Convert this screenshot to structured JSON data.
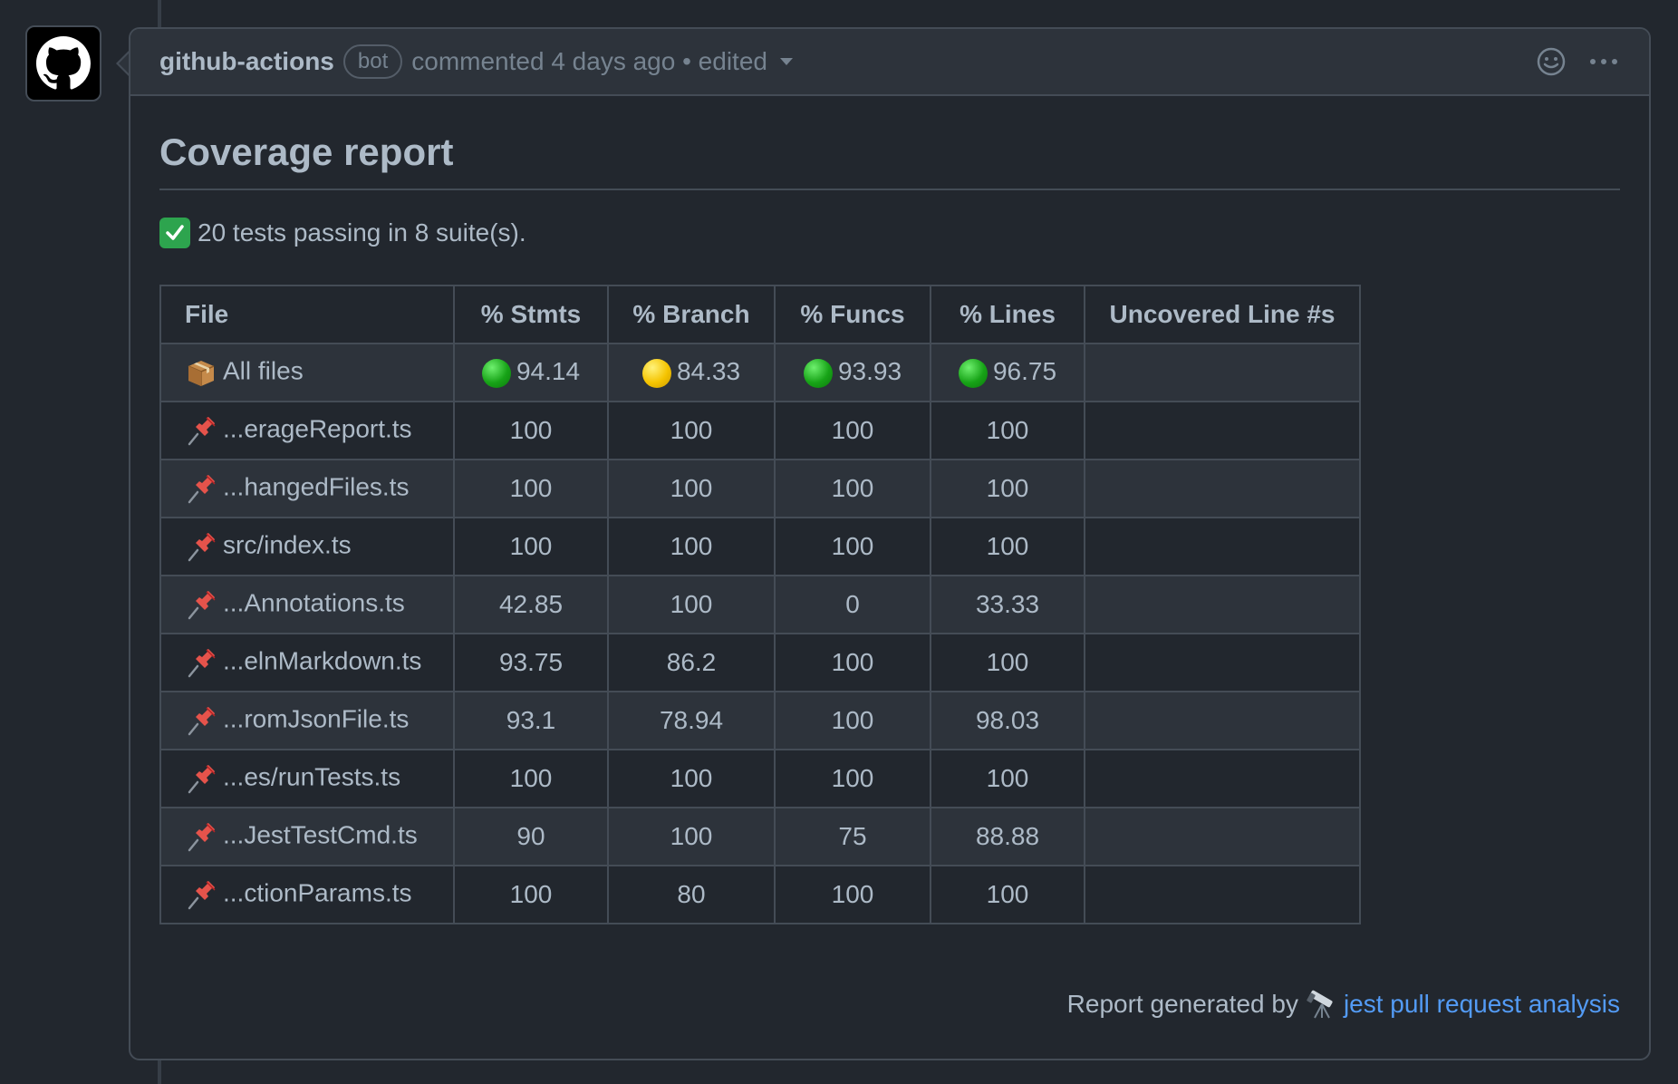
{
  "comment": {
    "author": "github-actions",
    "badge": "bot",
    "meta": "commented 4 days ago • edited"
  },
  "report": {
    "title": "Coverage report",
    "summary": "20 tests passing in 8 suite(s).",
    "columns": [
      "File",
      "% Stmts",
      "% Branch",
      "% Funcs",
      "% Lines",
      "Uncovered Line #s"
    ],
    "all_files": {
      "label": "All files",
      "stmts": "94.14",
      "branch": "84.33",
      "funcs": "93.93",
      "lines": "96.75",
      "uncovered": "",
      "status_colors": [
        "green",
        "yellow",
        "green",
        "green"
      ]
    },
    "rows": [
      {
        "file": "...erageReport.ts",
        "stmts": "100",
        "branch": "100",
        "funcs": "100",
        "lines": "100",
        "uncovered": ""
      },
      {
        "file": "...hangedFiles.ts",
        "stmts": "100",
        "branch": "100",
        "funcs": "100",
        "lines": "100",
        "uncovered": ""
      },
      {
        "file": "src/index.ts",
        "stmts": "100",
        "branch": "100",
        "funcs": "100",
        "lines": "100",
        "uncovered": ""
      },
      {
        "file": "...Annotations.ts",
        "stmts": "42.85",
        "branch": "100",
        "funcs": "0",
        "lines": "33.33",
        "uncovered": ""
      },
      {
        "file": "...elnMarkdown.ts",
        "stmts": "93.75",
        "branch": "86.2",
        "funcs": "100",
        "lines": "100",
        "uncovered": ""
      },
      {
        "file": "...romJsonFile.ts",
        "stmts": "93.1",
        "branch": "78.94",
        "funcs": "100",
        "lines": "98.03",
        "uncovered": ""
      },
      {
        "file": "...es/runTests.ts",
        "stmts": "100",
        "branch": "100",
        "funcs": "100",
        "lines": "100",
        "uncovered": ""
      },
      {
        "file": "...JestTestCmd.ts",
        "stmts": "90",
        "branch": "100",
        "funcs": "75",
        "lines": "88.88",
        "uncovered": ""
      },
      {
        "file": "...ctionParams.ts",
        "stmts": "100",
        "branch": "80",
        "funcs": "100",
        "lines": "100",
        "uncovered": ""
      }
    ],
    "footer_text": "Report generated by",
    "footer_link": "jest pull request analysis"
  },
  "icons": {
    "avatar": "github-mark-icon",
    "emoji_reaction": "smiley-icon",
    "more": "kebab-icon",
    "summary": "check-mark-icon",
    "all_files": "package-icon",
    "file": "pushpin-icon",
    "footer": "telescope-icon"
  },
  "colors": {
    "background": "#22272e",
    "header_bg": "#2d333b",
    "border": "#444c56",
    "text": "#adbac7",
    "muted": "#768390",
    "link": "#539bf5",
    "green": "#17a317",
    "yellow": "#f5c400"
  }
}
